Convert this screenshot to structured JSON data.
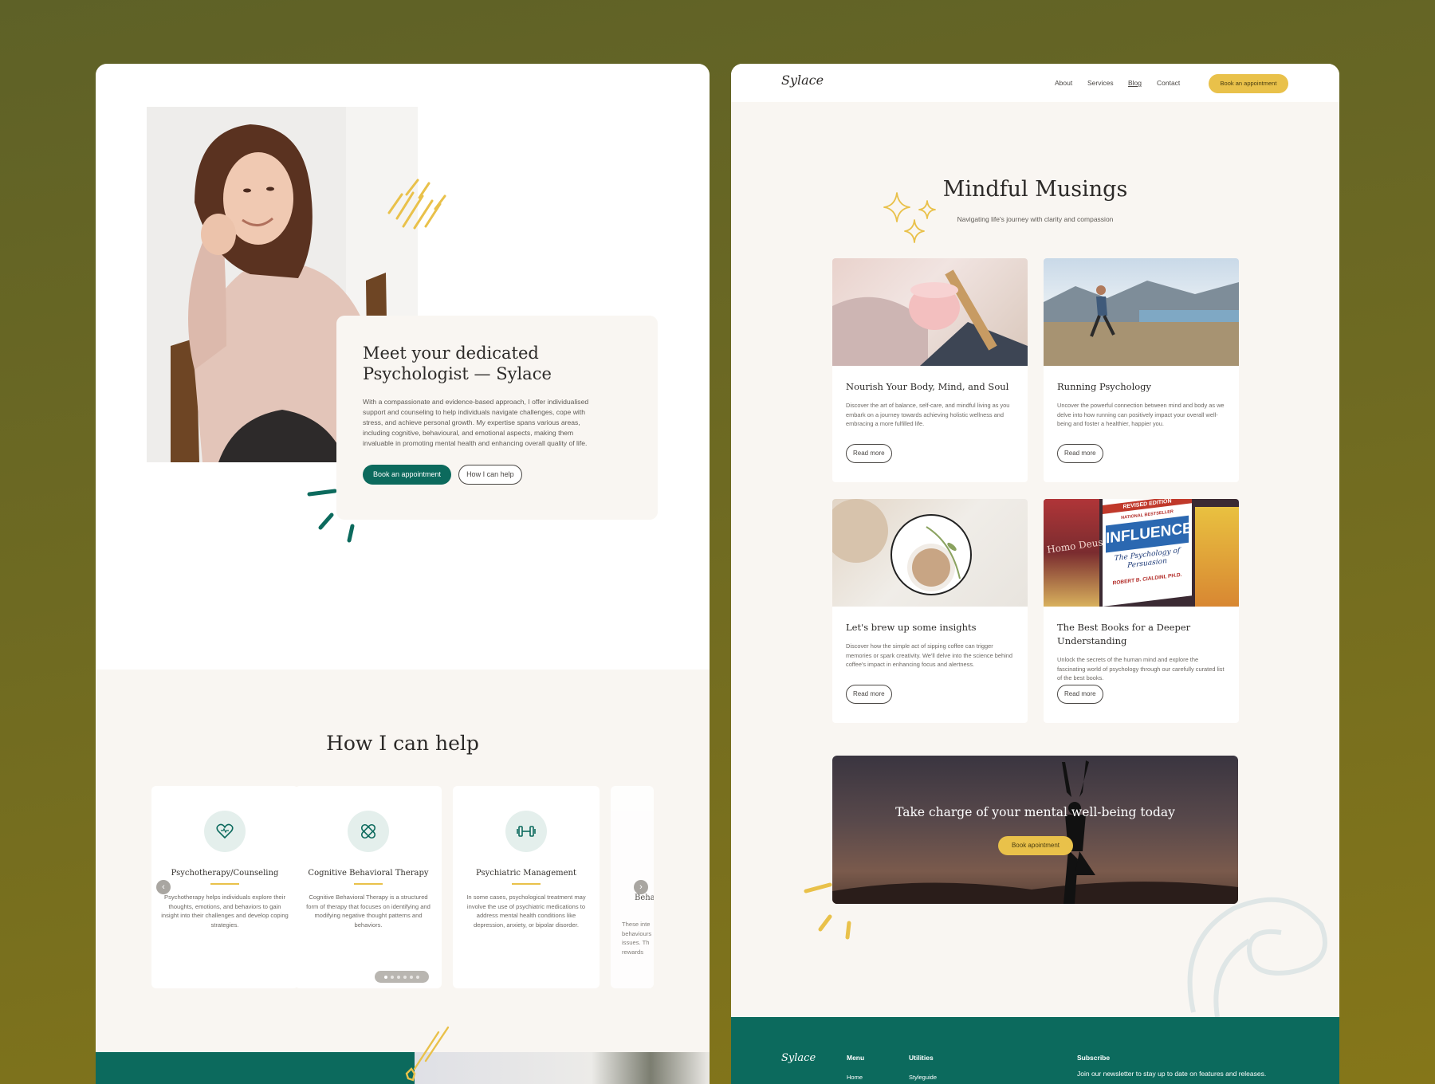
{
  "left": {
    "hero": {
      "title": "Meet your dedicated Psychologist — Sylace",
      "text": "With a compassionate and evidence-based approach, I offer individualised support and counseling to help individuals navigate challenges, cope with stress, and achieve personal growth. My expertise spans various areas, including cognitive, behavioural, and emotional aspects, making them invaluable in promoting mental health and enhancing overall quality of life.",
      "primary_button": "Book an appointment",
      "secondary_button": "How I can help"
    },
    "help": {
      "title": "How I can help",
      "services": [
        {
          "name": "Psychotherapy/Counseling",
          "text": "Psychotherapy helps individuals explore their thoughts, emotions, and behaviors to gain insight into their challenges and develop coping strategies.",
          "icon": "heart-icon"
        },
        {
          "name": "Cognitive Behavioral Therapy",
          "text": "Cognitive Behavioral Therapy is a structured form of therapy that focuses on identifying and modifying negative thought patterns and behaviors.",
          "icon": "bandage-icon"
        },
        {
          "name": "Psychiatric Management",
          "text": "In some cases, psychological treatment may involve the use of psychiatric medications to address mental health conditions like depression, anxiety, or bipolar disorder.",
          "icon": "dumbbell-icon"
        },
        {
          "name": "Beha",
          "text": "These inte behaviours issues. Th rewards",
          "icon": "partial-icon"
        }
      ],
      "prev_arrow": "‹",
      "next_arrow": "›",
      "dots_total": 6,
      "dots_active": 1
    }
  },
  "right": {
    "nav": {
      "logo": "Sylace",
      "links": [
        "About",
        "Services",
        "Blog",
        "Contact"
      ],
      "active_link": "Blog",
      "cta": "Book an appointment"
    },
    "blog": {
      "title": "Mindful Musings",
      "subtitle": "Navigating life's journey with clarity and compassion",
      "posts": [
        {
          "title": "Nourish Your Body, Mind, and Soul",
          "text": "Discover the art of balance, self-care, and mindful living as you embark on a journey towards achieving holistic wellness and embracing a more fulfilled life.",
          "button": "Read more"
        },
        {
          "title": "Running Psychology",
          "text": "Uncover the powerful connection between mind and body as we delve into how running can positively impact your overall well-being and foster a healthier, happier you.",
          "button": "Read more"
        },
        {
          "title": "Let's brew up some insights",
          "text": "Discover how the simple act of sipping coffee can trigger memories or spark creativity. We'll delve into the science behind coffee's impact in enhancing focus and alertness.",
          "button": "Read more"
        },
        {
          "title": "The Best Books for a Deeper Understanding",
          "text": "Unlock the secrets of the human mind and explore the fascinating world of psychology through our carefully curated list of the best books.",
          "button": "Read more"
        }
      ]
    },
    "cta": {
      "title": "Take charge of your mental well-being today",
      "button": "Book apointment"
    },
    "book_cover": {
      "edition": "REVISED EDITION",
      "badge": "NATIONAL BESTSELLER",
      "title": "INFLUENCE",
      "subtitle": "The Psychology of Persuasion",
      "author": "ROBERT B. CIALDINI, PH.D.",
      "side_book": "Homo Deus"
    },
    "footer": {
      "logo": "Sylace",
      "menu_heading": "Menu",
      "menu_item": "Home",
      "utilities_heading": "Utilities",
      "utilities_item": "Styleguide",
      "subscribe_heading": "Subscribe",
      "subscribe_text": "Join our newsletter to stay up to date on features and releases."
    }
  },
  "colors": {
    "brand_green": "#0c6a5d",
    "accent_yellow": "#e9c14a",
    "cream": "#f9f6f2"
  }
}
